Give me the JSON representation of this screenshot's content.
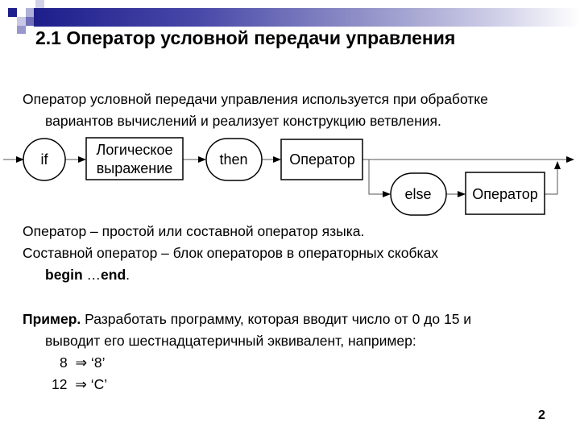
{
  "slide": {
    "title": "2.1 Оператор условной передачи управления",
    "intro": {
      "line1": "Оператор условной передачи управления используется при обработке",
      "line2": "вариантов вычислений и реализует конструкцию ветвления."
    },
    "diagram": {
      "nodes": {
        "if": "if",
        "condition_line1": "Логическое",
        "condition_line2": "выражение",
        "then": "then",
        "operator1": "Оператор",
        "else": "else",
        "operator2": "Оператор"
      }
    },
    "definitions": {
      "line1": "Оператор – простой или составной оператор языка.",
      "line2": "Составной оператор – блок операторов в операторных скобках",
      "begin": "begin",
      "ellipsis": " …",
      "end": "end",
      "dot": "."
    },
    "example": {
      "label": "Пример.",
      "line1_rest": " Разработать программу, которая вводит число от 0 до 15 и",
      "line2": "выводит его шестнадцатеричный эквивалент, например:",
      "rows": [
        {
          "input": "8",
          "arrow": "⇒",
          "output": "‘8’"
        },
        {
          "input": "12",
          "arrow": "⇒",
          "output": "‘C’"
        }
      ]
    },
    "page_number": "2"
  },
  "colors": {
    "dark_blue": "#1e1e8c",
    "mid_blue": "#6a6ab8",
    "light_blue": "#b8b8dc"
  }
}
